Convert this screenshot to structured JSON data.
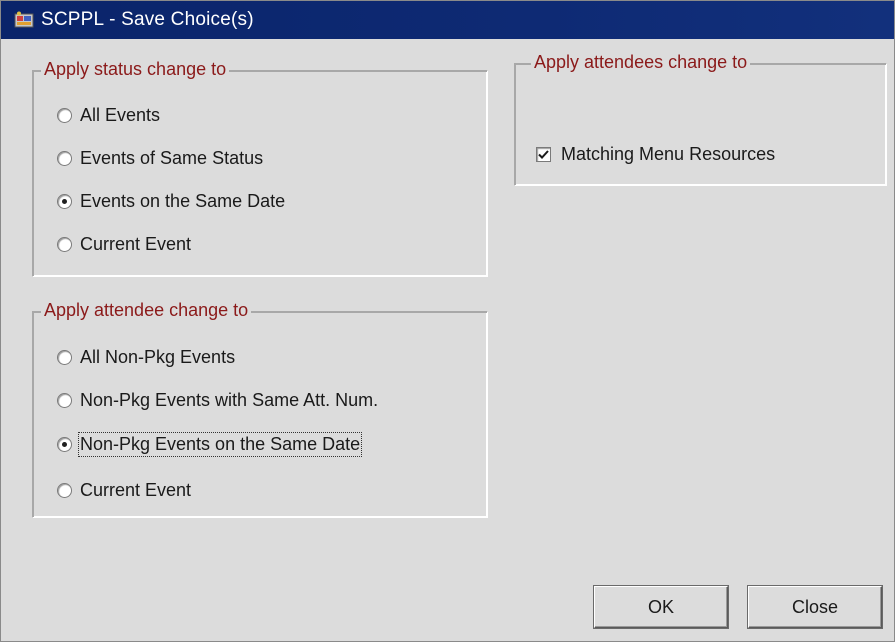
{
  "window": {
    "title": "SCPPL - Save Choice(s)",
    "icon": "app-icon"
  },
  "status_group": {
    "legend": "Apply status change to",
    "options": [
      {
        "label": "All Events",
        "checked": false
      },
      {
        "label": "Events of Same Status",
        "checked": false
      },
      {
        "label": "Events on the Same Date",
        "checked": true
      },
      {
        "label": "Current Event",
        "checked": false
      }
    ]
  },
  "attendee_group": {
    "legend": "Apply attendee change to",
    "options": [
      {
        "label": "All Non-Pkg Events",
        "checked": false
      },
      {
        "label": "Non-Pkg Events with Same Att. Num.",
        "checked": false
      },
      {
        "label": "Non-Pkg Events on the Same Date",
        "checked": true
      },
      {
        "label": "Current Event",
        "checked": false
      }
    ]
  },
  "attendees_group": {
    "legend": "Apply attendees change to",
    "checkbox": {
      "label": "Matching Menu Resources",
      "checked": true
    }
  },
  "buttons": {
    "ok": "OK",
    "close": "Close"
  },
  "colors": {
    "title_bar": "#0a246a",
    "legend_text": "#8b1a1a",
    "dialog_bg": "#dcdcdc"
  }
}
